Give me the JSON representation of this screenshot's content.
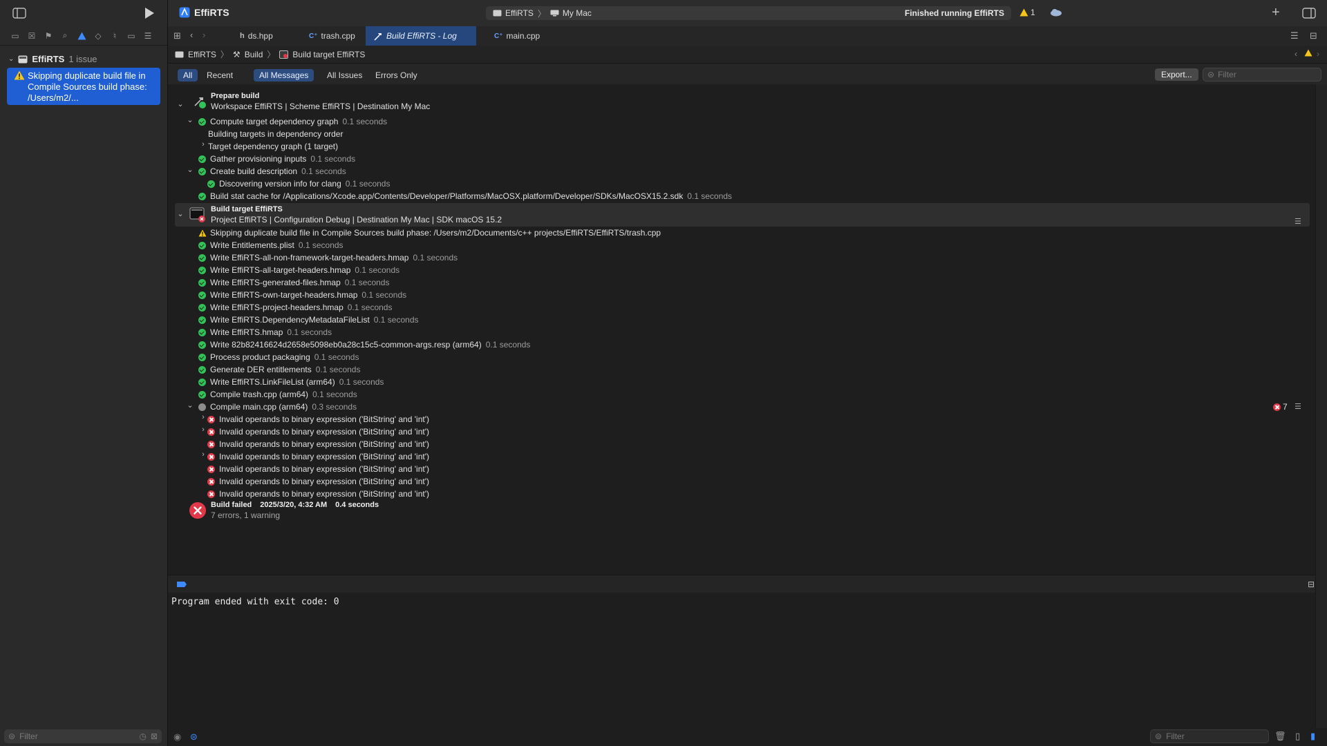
{
  "app": {
    "title": "EffiRTS",
    "scheme": "EffiRTS",
    "destination": "My Mac",
    "status": "Finished running EffiRTS",
    "warning_count": "1"
  },
  "tabs": [
    {
      "label": "ds.hpp",
      "icon": "header-file-icon"
    },
    {
      "label": "trash.cpp",
      "icon": "cpp-file-icon"
    },
    {
      "label": "Build EffiRTS - Log",
      "icon": "hammer-icon"
    },
    {
      "label": "main.cpp",
      "icon": "cpp-file-icon"
    }
  ],
  "jumpbar": [
    "EffiRTS",
    "Build",
    "Build target EffiRTS"
  ],
  "sidebar": {
    "project": "EffiRTS",
    "issue_count": "1 issue",
    "selected_issue": "Skipping duplicate build file in Compile Sources build phase: /Users/m2/...",
    "filter_placeholder": "Filter"
  },
  "filters": {
    "scope": [
      "All",
      "Recent"
    ],
    "types": [
      "All Messages",
      "All Issues",
      "Errors Only"
    ],
    "export": "Export...",
    "placeholder": "Filter"
  },
  "log": {
    "prepare": {
      "title": "Prepare build",
      "subtitle": "Workspace EffiRTS | Scheme EffiRTS | Destination My Mac",
      "rows": [
        {
          "text": "Compute target dependency graph",
          "dur": "0.1 seconds"
        },
        {
          "text": "Building targets in dependency order",
          "dur": ""
        },
        {
          "text": "Target dependency graph (1 target)",
          "dur": ""
        },
        {
          "text": "Gather provisioning inputs",
          "dur": "0.1 seconds"
        },
        {
          "text": "Create build description",
          "dur": "0.1 seconds"
        },
        {
          "text": "Discovering version info for clang",
          "dur": "0.1 seconds"
        },
        {
          "text": "Build stat cache for /Applications/Xcode.app/Contents/Developer/Platforms/MacOSX.platform/Developer/SDKs/MacOSX15.2.sdk",
          "dur": "0.1 seconds"
        }
      ]
    },
    "target": {
      "title": "Build target EffiRTS",
      "subtitle": "Project EffiRTS | Configuration Debug | Destination My Mac | SDK macOS 15.2",
      "warning": "Skipping duplicate build file in Compile Sources build phase: /Users/m2/Documents/c++ projects/EffiRTS/EffiRTS/trash.cpp",
      "steps": [
        {
          "text": "Write Entitlements.plist",
          "dur": "0.1 seconds"
        },
        {
          "text": "Write EffiRTS-all-non-framework-target-headers.hmap",
          "dur": "0.1 seconds"
        },
        {
          "text": "Write EffiRTS-all-target-headers.hmap",
          "dur": "0.1 seconds"
        },
        {
          "text": "Write EffiRTS-generated-files.hmap",
          "dur": "0.1 seconds"
        },
        {
          "text": "Write EffiRTS-own-target-headers.hmap",
          "dur": "0.1 seconds"
        },
        {
          "text": "Write EffiRTS-project-headers.hmap",
          "dur": "0.1 seconds"
        },
        {
          "text": "Write EffiRTS.DependencyMetadataFileList",
          "dur": "0.1 seconds"
        },
        {
          "text": "Write EffiRTS.hmap",
          "dur": "0.1 seconds"
        },
        {
          "text": "Write 82b82416624d2658e5098eb0a28c15c5-common-args.resp (arm64)",
          "dur": "0.1 seconds"
        },
        {
          "text": "Process product packaging",
          "dur": "0.1 seconds"
        },
        {
          "text": "Generate DER entitlements",
          "dur": "0.1 seconds"
        },
        {
          "text": "Write EffiRTS.LinkFileList (arm64)",
          "dur": "0.1 seconds"
        },
        {
          "text": "Compile trash.cpp (arm64)",
          "dur": "0.1 seconds"
        }
      ],
      "compile_main": {
        "text": "Compile main.cpp (arm64)",
        "dur": "0.3 seconds",
        "error_count": "7"
      },
      "errors": [
        "Invalid operands to binary expression ('BitString' and 'int')",
        "Invalid operands to binary expression ('BitString' and 'int')",
        "Invalid operands to binary expression ('BitString' and 'int')",
        "Invalid operands to binary expression ('BitString' and 'int')",
        "Invalid operands to binary expression ('BitString' and 'int')",
        "Invalid operands to binary expression ('BitString' and 'int')",
        "Invalid operands to binary expression ('BitString' and 'int')"
      ]
    },
    "result": {
      "title": "Build failed",
      "date": "2025/3/20, 4:32 AM",
      "duration": "0.4 seconds",
      "summary": "7 errors, 1 warning"
    }
  },
  "console": {
    "output": "Program ended with exit code: 0",
    "filter_placeholder": "Filter"
  },
  "colors": {
    "accent": "#1f5fd3",
    "success": "#35c15a",
    "error": "#e2394a",
    "warning": "#f5c518"
  }
}
